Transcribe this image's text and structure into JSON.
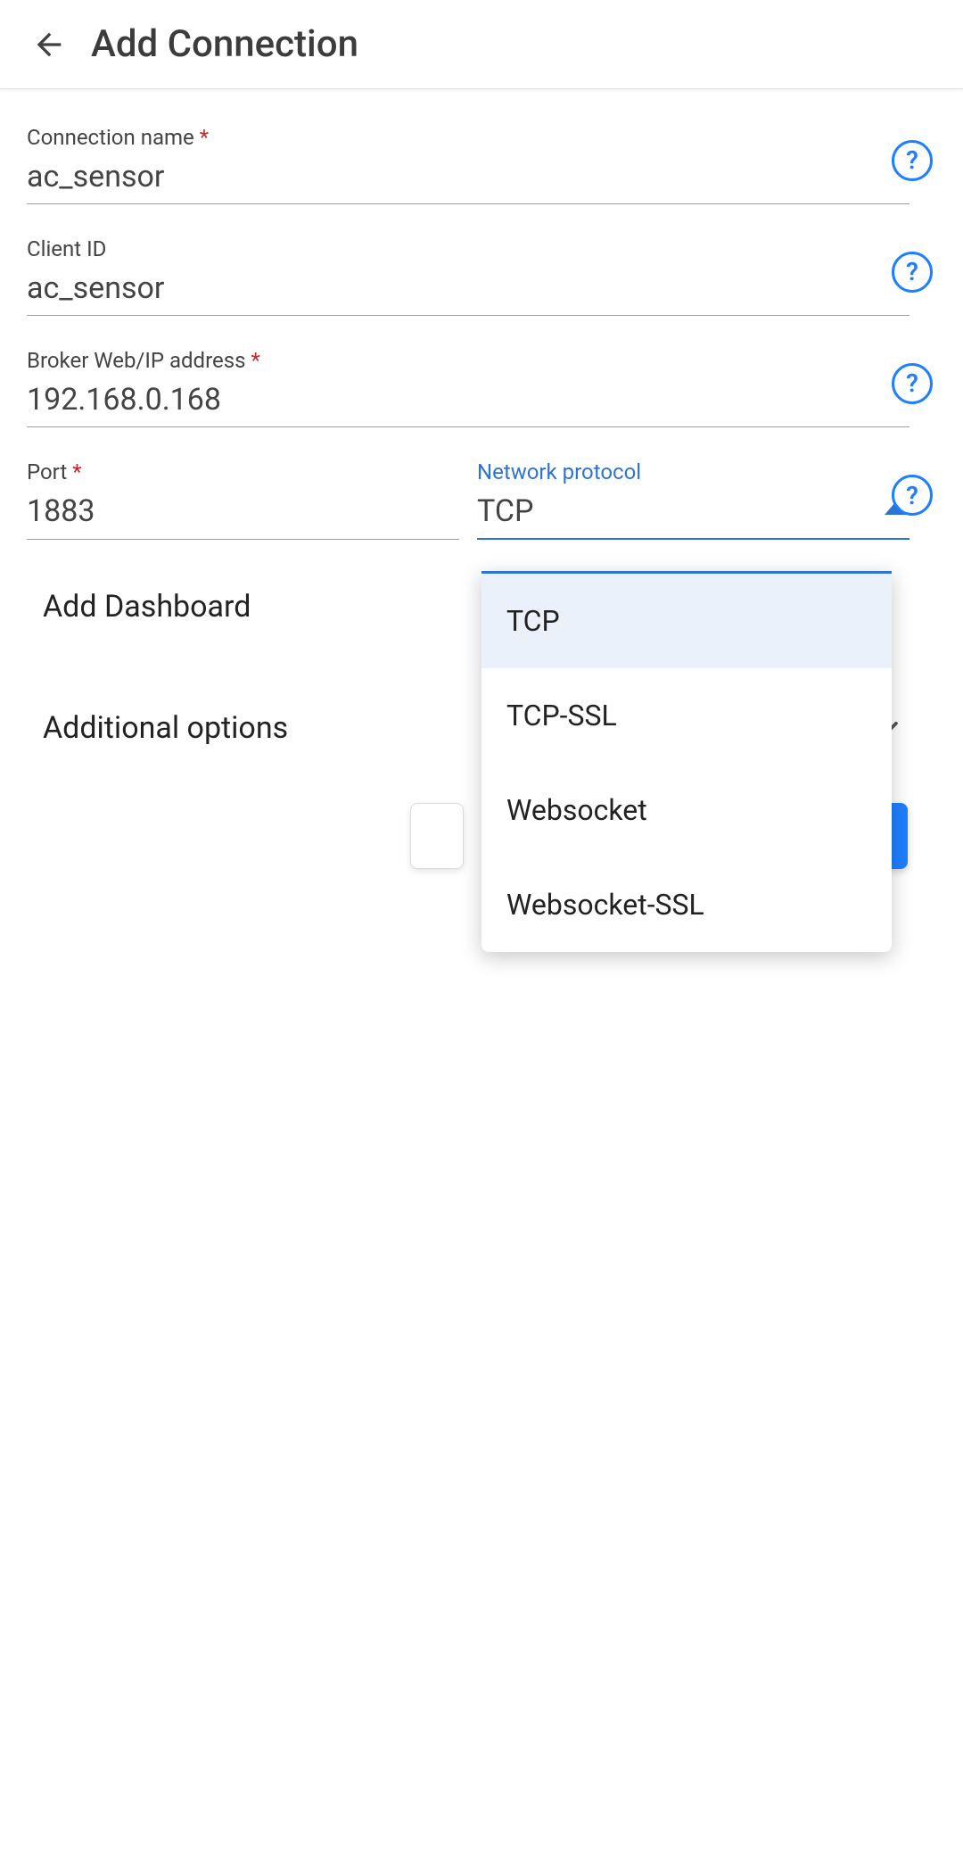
{
  "appbar": {
    "title": "Add Connection"
  },
  "fields": {
    "connection_name": {
      "label": "Connection name",
      "value": "ac_sensor"
    },
    "client_id": {
      "label": "Client ID",
      "value": "ac_sensor"
    },
    "broker": {
      "label": "Broker Web/IP address",
      "value": "192.168.0.168"
    },
    "port": {
      "label": "Port",
      "value": "1883"
    },
    "protocol": {
      "label": "Network protocol",
      "value": "TCP"
    }
  },
  "protocol_options": [
    "TCP",
    "TCP-SSL",
    "Websocket",
    "Websocket-SSL"
  ],
  "sections": {
    "add_dashboard": "Add Dashboard",
    "additional_options": "Additional options"
  }
}
